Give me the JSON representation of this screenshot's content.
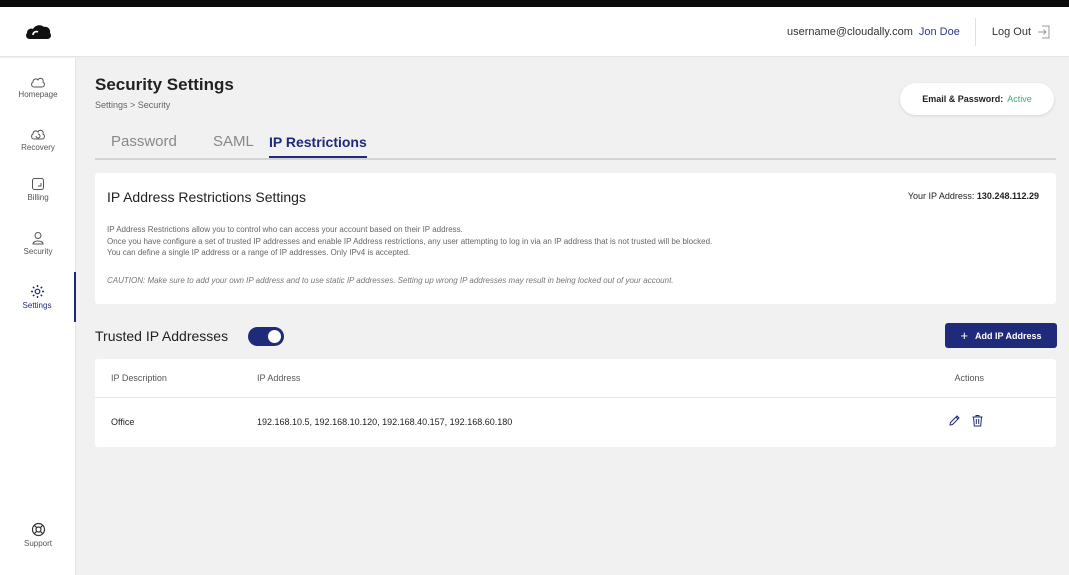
{
  "header": {
    "email": "username@cloudally.com",
    "name": "Jon Doe",
    "logout_label": "Log Out"
  },
  "sidebar": {
    "items": [
      {
        "label": "Homepage",
        "icon": "cloud-icon"
      },
      {
        "label": "Recovery",
        "icon": "recovery-icon"
      },
      {
        "label": "Billing",
        "icon": "billing-icon"
      },
      {
        "label": "Security",
        "icon": "user-icon"
      },
      {
        "label": "Settings",
        "icon": "gear-icon",
        "active": true
      }
    ],
    "support_label": "Support"
  },
  "page": {
    "title": "Security Settings",
    "breadcrumb": "Settings > Security",
    "status_label": "Email & Password:",
    "status_value": "Active"
  },
  "tabs": [
    {
      "label": "Password"
    },
    {
      "label": "SAML"
    },
    {
      "label": "IP Restrictions",
      "active": true
    }
  ],
  "info": {
    "title": "IP Address Restrictions Settings",
    "ip_label": "Your IP Address:",
    "ip_value": "130.248.112.29",
    "lines": [
      "IP Address Restrictions allow you to control who can access your account based on their IP address.",
      "Once you have configure a set of trusted IP addresses and enable IP Address restrictions, any user attempting to log in via an IP address that is not trusted will be blocked.",
      "You can define a single IP address or a range of IP addresses. Only IPv4 is accepted."
    ],
    "caution": "CAUTION: Make sure to add your own IP address and to use static IP addresses. Setting up wrong IP addresses may result in being locked out of your account."
  },
  "trusted": {
    "label": "Trusted IP Addresses",
    "enabled": true,
    "add_button": "Add IP Address"
  },
  "table": {
    "columns": [
      "IP Description",
      "IP Address",
      "Actions"
    ],
    "rows": [
      {
        "description": "Office",
        "addresses": "192.168.10.5, 192.168.10.120, 192.168.40.157, 192.168.60.180"
      }
    ]
  },
  "colors": {
    "accent": "#1f2a7a",
    "active_status": "#3cb371",
    "background": "#f1f1f1"
  }
}
